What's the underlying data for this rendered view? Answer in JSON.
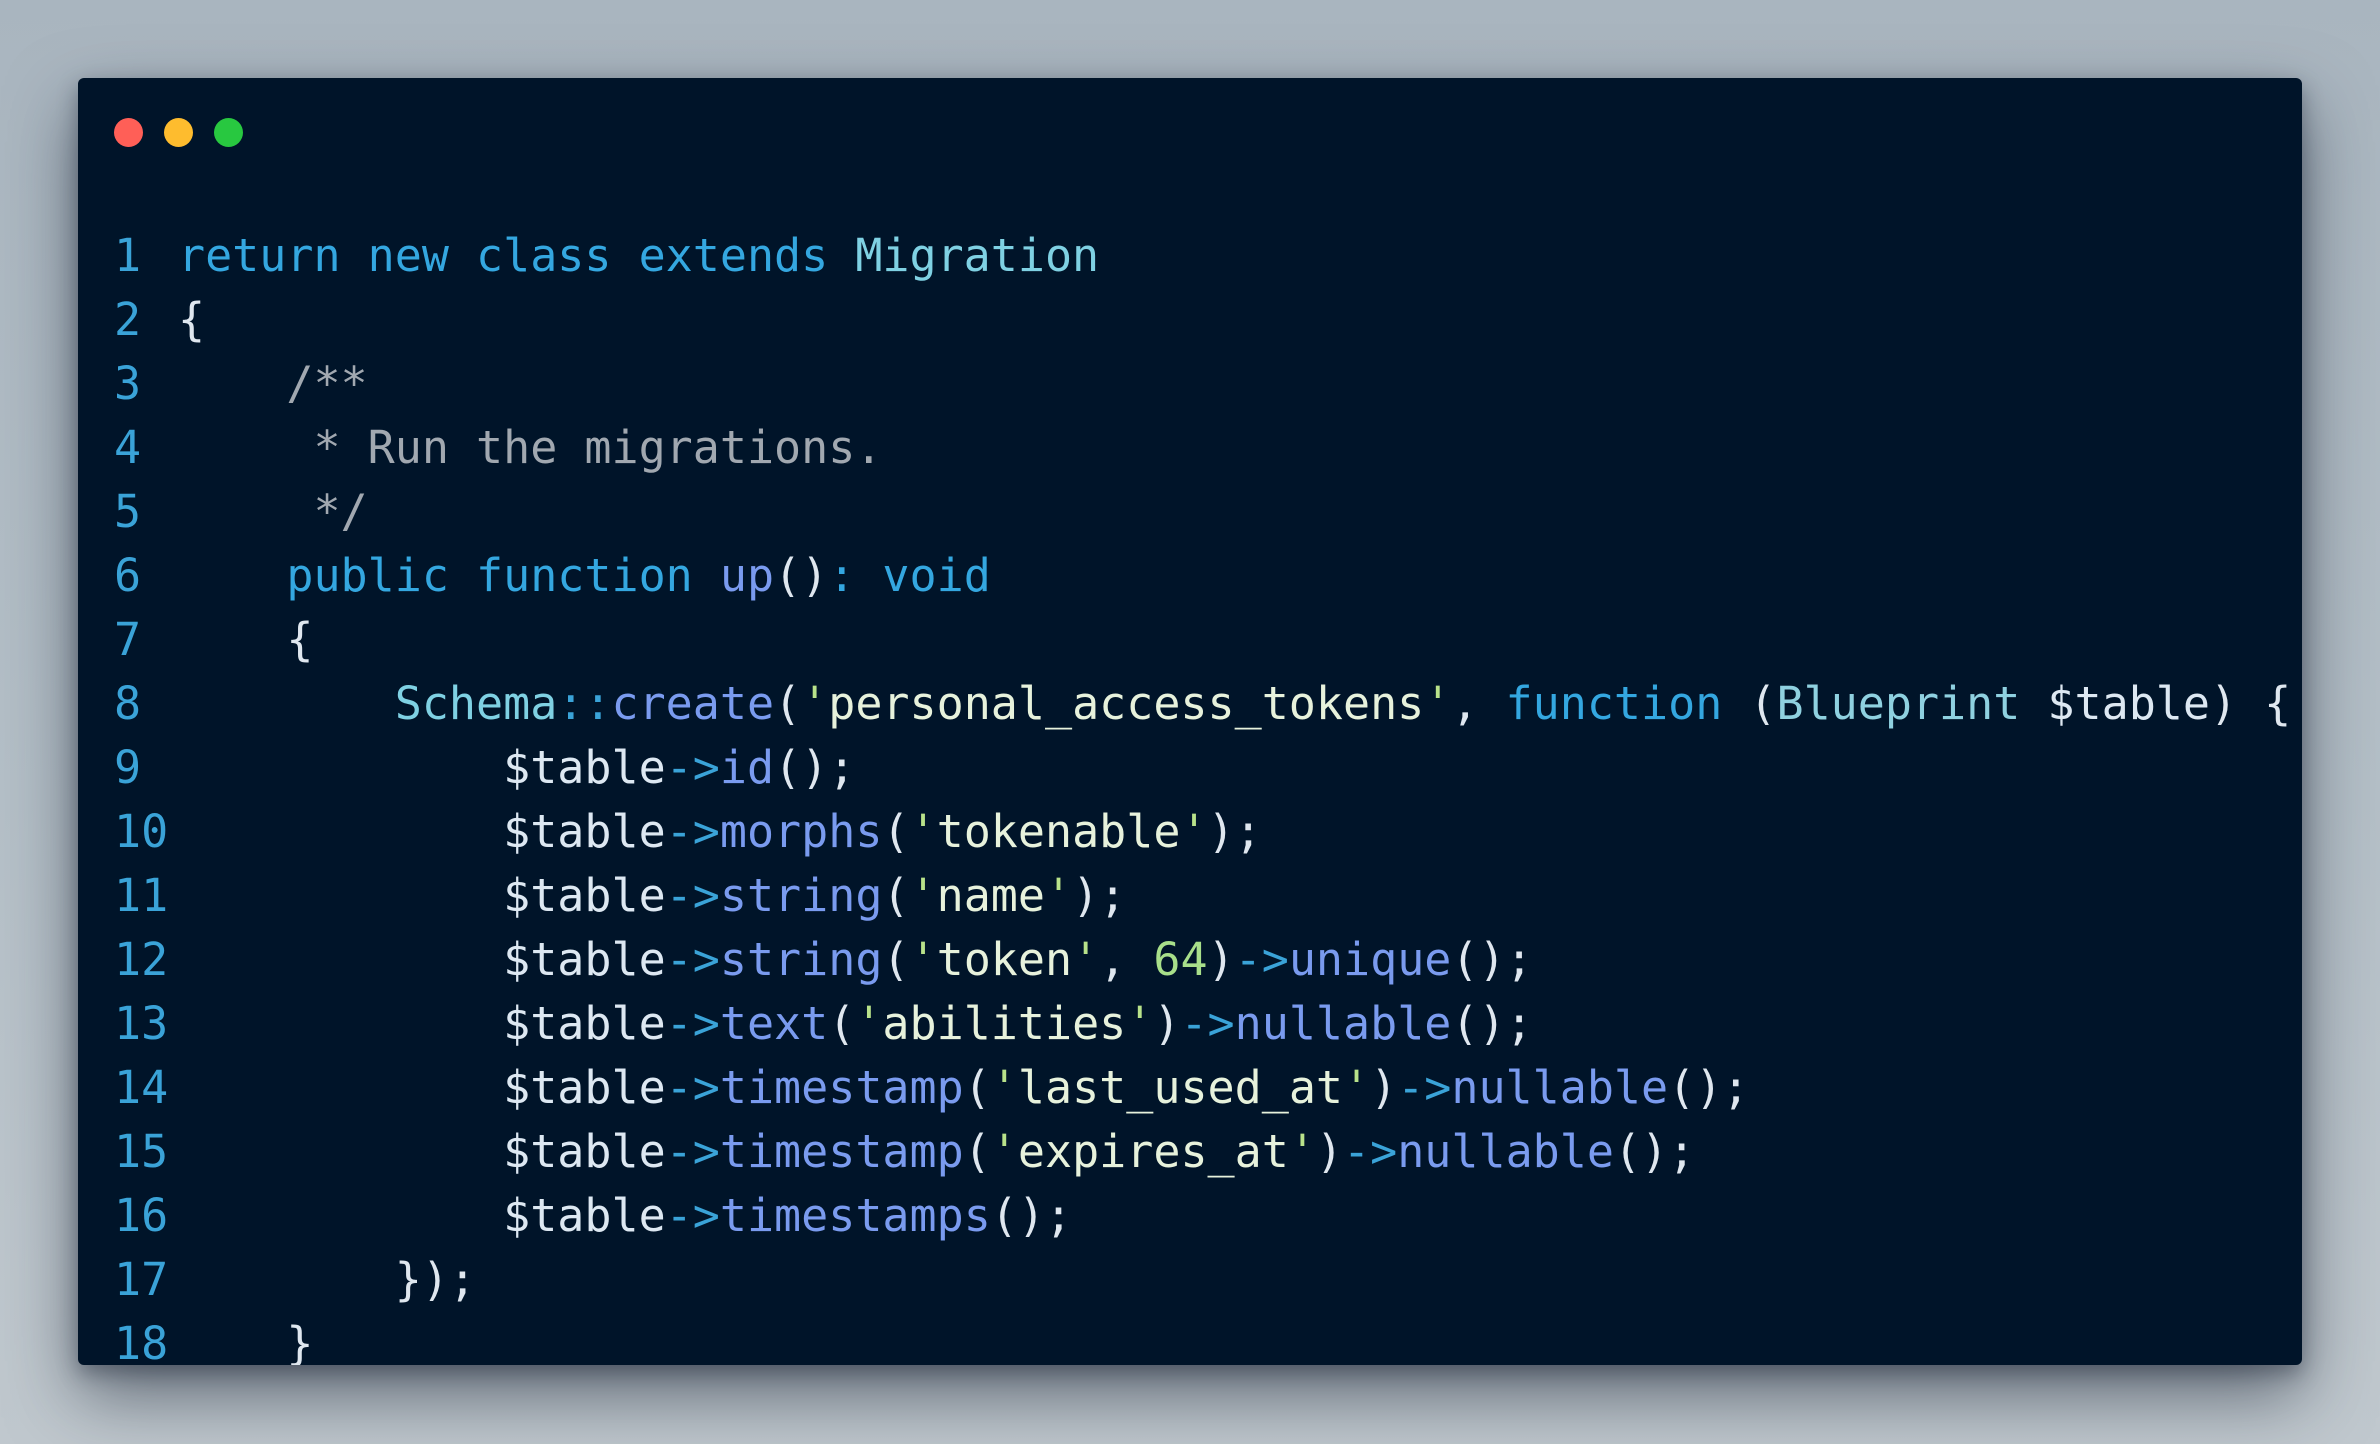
{
  "window": {
    "controls": [
      "close",
      "minimize",
      "maximize"
    ]
  },
  "colors": {
    "background": "#b4bfc7",
    "editor_bg": "#001429",
    "line_number": "#3aa3d8",
    "keyword": "#34a7e0",
    "comment": "#a1a8b0",
    "function": "#7a9bef",
    "string": "#e7f2dc",
    "number": "#a8df8a"
  },
  "code": {
    "lines": [
      {
        "n": "1",
        "tokens": [
          [
            "kw",
            "return new class extends "
          ],
          [
            "cls",
            "Migration"
          ]
        ]
      },
      {
        "n": "2",
        "tokens": [
          [
            "pl",
            "{"
          ]
        ]
      },
      {
        "n": "3",
        "tokens": [
          [
            "cm",
            "    /**"
          ]
        ]
      },
      {
        "n": "4",
        "tokens": [
          [
            "cm",
            "     * Run the migrations."
          ]
        ]
      },
      {
        "n": "5",
        "tokens": [
          [
            "cm",
            "     */"
          ]
        ]
      },
      {
        "n": "6",
        "tokens": [
          [
            "kw",
            "    public function "
          ],
          [
            "fn",
            "up"
          ],
          [
            "pl",
            "()"
          ],
          [
            "kw",
            ": void"
          ]
        ]
      },
      {
        "n": "7",
        "tokens": [
          [
            "pl",
            "    {"
          ]
        ]
      },
      {
        "n": "8",
        "tokens": [
          [
            "cls",
            "        Schema"
          ],
          [
            "op",
            "::"
          ],
          [
            "fn",
            "create"
          ],
          [
            "pl",
            "("
          ],
          [
            "q",
            "'"
          ],
          [
            "str",
            "personal_access_tokens"
          ],
          [
            "q",
            "'"
          ],
          [
            "pl",
            ", "
          ],
          [
            "kw",
            "function "
          ],
          [
            "pl",
            "("
          ],
          [
            "typ",
            "Blueprint "
          ],
          [
            "var",
            "$table"
          ],
          [
            "pl",
            ") {"
          ]
        ]
      },
      {
        "n": "9",
        "tokens": [
          [
            "var",
            "            $table"
          ],
          [
            "op",
            "->"
          ],
          [
            "fn",
            "id"
          ],
          [
            "pl",
            "();"
          ]
        ]
      },
      {
        "n": "10",
        "tokens": [
          [
            "var",
            "            $table"
          ],
          [
            "op",
            "->"
          ],
          [
            "fn",
            "morphs"
          ],
          [
            "pl",
            "("
          ],
          [
            "q",
            "'"
          ],
          [
            "str",
            "tokenable"
          ],
          [
            "q",
            "'"
          ],
          [
            "pl",
            ");"
          ]
        ]
      },
      {
        "n": "11",
        "tokens": [
          [
            "var",
            "            $table"
          ],
          [
            "op",
            "->"
          ],
          [
            "fn",
            "string"
          ],
          [
            "pl",
            "("
          ],
          [
            "q",
            "'"
          ],
          [
            "str",
            "name"
          ],
          [
            "q",
            "'"
          ],
          [
            "pl",
            ");"
          ]
        ]
      },
      {
        "n": "12",
        "tokens": [
          [
            "var",
            "            $table"
          ],
          [
            "op",
            "->"
          ],
          [
            "fn",
            "string"
          ],
          [
            "pl",
            "("
          ],
          [
            "q",
            "'"
          ],
          [
            "str",
            "token"
          ],
          [
            "q",
            "'"
          ],
          [
            "pl",
            ", "
          ],
          [
            "num",
            "64"
          ],
          [
            "pl",
            ")"
          ],
          [
            "op",
            "->"
          ],
          [
            "fn",
            "unique"
          ],
          [
            "pl",
            "();"
          ]
        ]
      },
      {
        "n": "13",
        "tokens": [
          [
            "var",
            "            $table"
          ],
          [
            "op",
            "->"
          ],
          [
            "fn",
            "text"
          ],
          [
            "pl",
            "("
          ],
          [
            "q",
            "'"
          ],
          [
            "str",
            "abilities"
          ],
          [
            "q",
            "'"
          ],
          [
            "pl",
            ")"
          ],
          [
            "op",
            "->"
          ],
          [
            "fn",
            "nullable"
          ],
          [
            "pl",
            "();"
          ]
        ]
      },
      {
        "n": "14",
        "tokens": [
          [
            "var",
            "            $table"
          ],
          [
            "op",
            "->"
          ],
          [
            "fn",
            "timestamp"
          ],
          [
            "pl",
            "("
          ],
          [
            "q",
            "'"
          ],
          [
            "str",
            "last_used_at"
          ],
          [
            "q",
            "'"
          ],
          [
            "pl",
            ")"
          ],
          [
            "op",
            "->"
          ],
          [
            "fn",
            "nullable"
          ],
          [
            "pl",
            "();"
          ]
        ]
      },
      {
        "n": "15",
        "tokens": [
          [
            "var",
            "            $table"
          ],
          [
            "op",
            "->"
          ],
          [
            "fn",
            "timestamp"
          ],
          [
            "pl",
            "("
          ],
          [
            "q",
            "'"
          ],
          [
            "str",
            "expires_at"
          ],
          [
            "q",
            "'"
          ],
          [
            "pl",
            ")"
          ],
          [
            "op",
            "->"
          ],
          [
            "fn",
            "nullable"
          ],
          [
            "pl",
            "();"
          ]
        ]
      },
      {
        "n": "16",
        "tokens": [
          [
            "var",
            "            $table"
          ],
          [
            "op",
            "->"
          ],
          [
            "fn",
            "timestamps"
          ],
          [
            "pl",
            "();"
          ]
        ]
      },
      {
        "n": "17",
        "tokens": [
          [
            "pl",
            "        });"
          ]
        ]
      },
      {
        "n": "18",
        "tokens": [
          [
            "pl",
            "    }"
          ]
        ]
      }
    ]
  }
}
